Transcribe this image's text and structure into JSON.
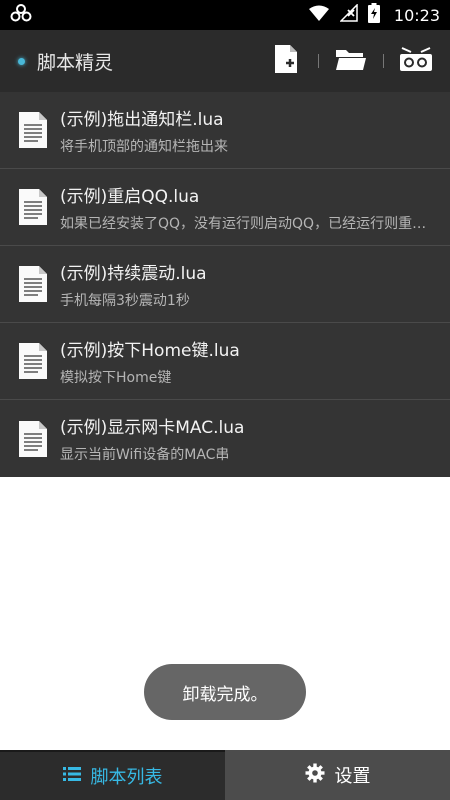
{
  "status_bar": {
    "time": "10:23",
    "icons": [
      "app-logo-icon",
      "wifi-icon",
      "signal-icon",
      "battery-charging-icon"
    ]
  },
  "app_bar": {
    "title": "脚本精灵",
    "accent_color": "#49b8d8",
    "actions": [
      "new-file-icon",
      "folder-icon",
      "record-icon"
    ]
  },
  "scripts": [
    {
      "name": "(示例)拖出通知栏.lua",
      "desc": "将手机顶部的通知栏拖出来"
    },
    {
      "name": "(示例)重启QQ.lua",
      "desc": "如果已经安装了QQ，没有运行则启动QQ，已经运行则重启QQ"
    },
    {
      "name": "(示例)持续震动.lua",
      "desc": "手机每隔3秒震动1秒"
    },
    {
      "name": "(示例)按下Home键.lua",
      "desc": "模拟按下Home键"
    },
    {
      "name": "(示例)显示网卡MAC.lua",
      "desc": "显示当前Wifi设备的MAC串"
    }
  ],
  "toast": {
    "message": "卸载完成。"
  },
  "bottom_nav": {
    "active_color": "#37b9e4",
    "tabs": [
      {
        "label": "脚本列表",
        "icon": "list-icon",
        "active": true
      },
      {
        "label": "设置",
        "icon": "gear-icon",
        "active": false
      }
    ]
  }
}
